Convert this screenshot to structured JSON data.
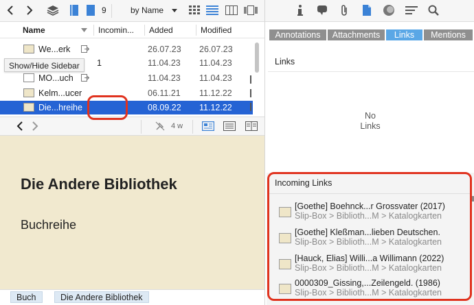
{
  "left_toolbar": {
    "count": "9",
    "sort_label": "by Name"
  },
  "table": {
    "columns": [
      "Name",
      "Incomin...",
      "Added",
      "Modified"
    ],
    "rows": [
      {
        "name": "We...erk",
        "incoming": "",
        "added": "26.07.23",
        "modified": "26.07.23",
        "icon": "note",
        "has_link": true,
        "selected": false
      },
      {
        "name": "",
        "incoming": "1",
        "added": "11.04.23",
        "modified": "11.04.23",
        "icon": "note",
        "has_link": false,
        "selected": false
      },
      {
        "name": "MO...uch",
        "incoming": "",
        "added": "11.04.23",
        "modified": "11.04.23",
        "icon": "plain",
        "has_link": true,
        "selected": false
      },
      {
        "name": "Kelm...ucer",
        "incoming": "",
        "added": "06.11.21",
        "modified": "11.12.22",
        "icon": "note",
        "has_link": false,
        "selected": false
      },
      {
        "name": "Die...hreihe",
        "incoming": "",
        "added": "08.09.22",
        "modified": "11.12.22",
        "icon": "note",
        "has_link": false,
        "selected": true
      }
    ]
  },
  "tooltip": "Show/Hide Sidebar",
  "editor_toolbar": {
    "word_count": "4 w"
  },
  "editor": {
    "title": "Die Andere Bibliothek",
    "body": "Buchreihe"
  },
  "tags": [
    "Buch",
    "Die Andere Bibliothek"
  ],
  "right_pane": {
    "tabs": [
      {
        "label": "Annotations",
        "active": false
      },
      {
        "label": "Attachments",
        "active": false
      },
      {
        "label": "Links",
        "active": true
      },
      {
        "label": "Mentions",
        "active": false
      }
    ],
    "links_heading": "Links",
    "no_links_line1": "No",
    "no_links_line2": "Links",
    "incoming_heading": "Incoming Links",
    "incoming_links": [
      {
        "title": "[Goethe] Boehnck...r Grossvater (2017)",
        "path": "Slip-Box > Biblioth...M > Katalogkarten"
      },
      {
        "title": "[Goethe] Kleßman...lieben Deutschen.",
        "path": "Slip-Box > Biblioth...M > Katalogkarten"
      },
      {
        "title": "[Hauck, Elias] Willi...a Willimann (2022)",
        "path": "Slip-Box > Biblioth...M > Katalogkarten"
      },
      {
        "title": "0000309_Gissing,...Zeilengeld. (1986)",
        "path": "Slip-Box > Biblioth...M > Katalogkarten"
      }
    ]
  },
  "colors": {
    "selection": "#2563d4",
    "accent_tab": "#5aa7e6",
    "note_paper": "#f1e9cf",
    "annotation_red": "#e0321e"
  }
}
